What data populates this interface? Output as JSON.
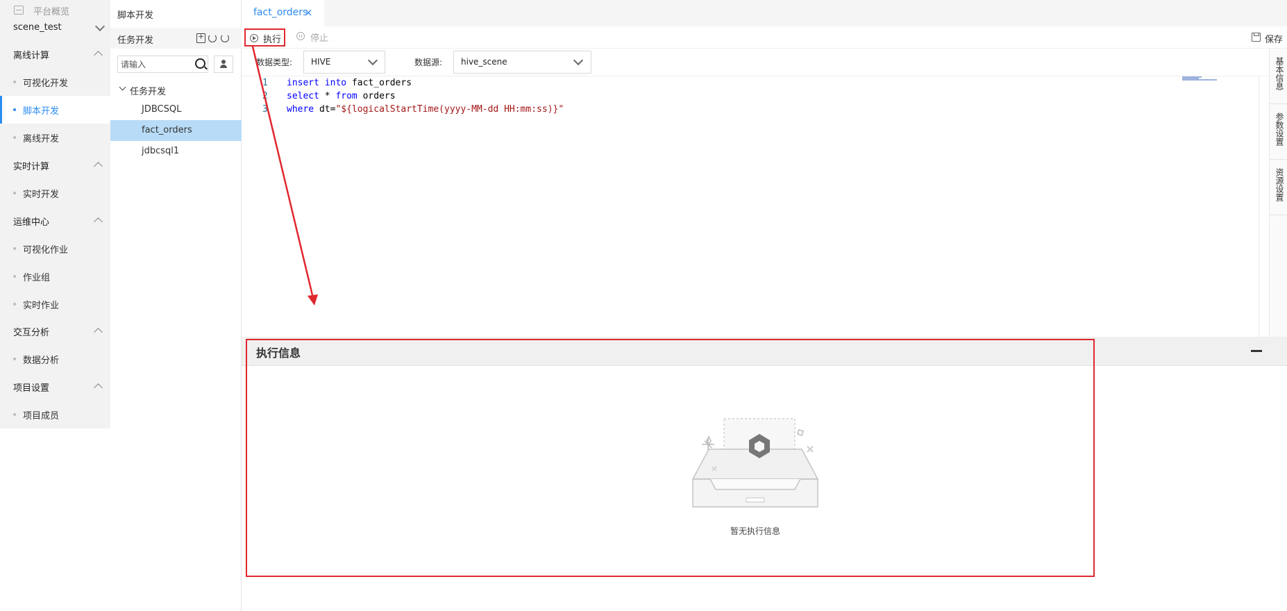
{
  "nav": {
    "header": "平台概览",
    "project": "scene_test",
    "groups": [
      {
        "label": "离线计算",
        "items": [
          "可视化开发",
          "脚本开发",
          "离线开发"
        ]
      },
      {
        "label": "实时计算",
        "items": [
          "实时开发"
        ]
      },
      {
        "label": "运维中心",
        "items": [
          "可视化作业",
          "作业组",
          "实时作业"
        ]
      },
      {
        "label": "交互分析",
        "items": [
          "数据分析"
        ]
      },
      {
        "label": "项目设置",
        "items": [
          "项目成员"
        ]
      }
    ],
    "active_item": "脚本开发",
    "accent_color": "#2d8cf0"
  },
  "tree": {
    "title": "脚本开发",
    "subheader": "任务开发",
    "search_placeholder": "请输入",
    "folder": "任务开发",
    "nodes": [
      "JDBCSQL",
      "fact_orders",
      "jdbcsql1"
    ],
    "selected": "fact_orders"
  },
  "tab": {
    "label": "fact_orders",
    "close": "×"
  },
  "toolbar": {
    "run": "执行",
    "stop": "停止",
    "save": "保存"
  },
  "config": {
    "type_label": "数据类型:",
    "type_value": "HIVE",
    "source_label": "数据源:",
    "source_value": "hive_scene"
  },
  "editor": {
    "lines": [
      {
        "no": "1",
        "text": "insert into fact_orders"
      },
      {
        "no": "2",
        "text": "select * from orders"
      },
      {
        "no": "3",
        "text": "where dt=\"${logicalStartTime(yyyy-MM-dd HH:mm:ss)}\""
      }
    ]
  },
  "side_tabs": [
    "基本信息",
    "参数设置",
    "资源设置"
  ],
  "exec": {
    "title": "执行信息",
    "empty_text": "暂无执行信息"
  },
  "highlight_color": "#e0272e"
}
